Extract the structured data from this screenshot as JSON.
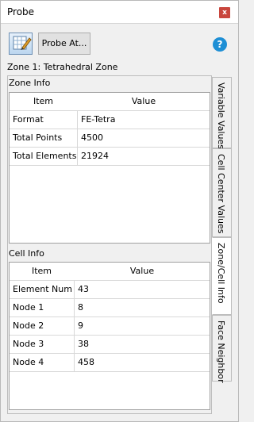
{
  "window": {
    "title": "Probe",
    "close_label": "x"
  },
  "toolbar": {
    "probe_at_label": "Probe At...",
    "help_label": "?"
  },
  "zone_label": "Zone 1: Tetrahedral Zone",
  "zone_info": {
    "label": "Zone Info",
    "headers": [
      "Item",
      "Value"
    ],
    "rows": [
      [
        "Format",
        "FE-Tetra"
      ],
      [
        "Total Points",
        "4500"
      ],
      [
        "Total Elements",
        "21924"
      ]
    ]
  },
  "cell_info": {
    "label": "Cell Info",
    "headers": [
      "Item",
      "Value"
    ],
    "rows": [
      [
        "Element Num",
        "43"
      ],
      [
        "Node 1",
        "8"
      ],
      [
        "Node 2",
        "9"
      ],
      [
        "Node 3",
        "38"
      ],
      [
        "Node 4",
        "458"
      ]
    ]
  },
  "tabs": [
    {
      "label": "Variable Values",
      "active": false
    },
    {
      "label": "Cell Center Values",
      "active": false
    },
    {
      "label": "Zone/Cell Info",
      "active": true
    },
    {
      "label": "Face Neighbor",
      "active": false
    }
  ],
  "colors": {
    "accent": "#1e8fd5",
    "close": "#c9463d"
  },
  "icons": [
    "probe-tool-icon",
    "help-icon",
    "close-icon"
  ]
}
